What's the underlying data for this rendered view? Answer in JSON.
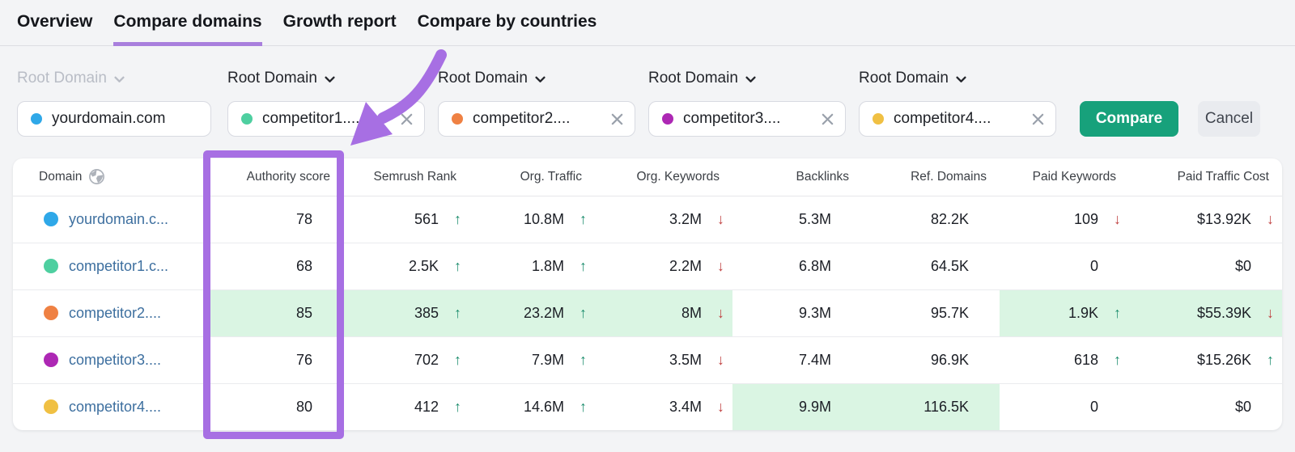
{
  "tabs": [
    {
      "label": "Overview",
      "active": false
    },
    {
      "label": "Compare domains",
      "active": true
    },
    {
      "label": "Growth report",
      "active": false
    },
    {
      "label": "Compare by countries",
      "active": false
    }
  ],
  "selectors": [
    {
      "type_label": "Root Domain",
      "disabled": true,
      "domain": "yourdomain.com",
      "dot_color": "#2fa8e8",
      "removable": false
    },
    {
      "type_label": "Root Domain",
      "disabled": false,
      "domain": "competitor1....",
      "dot_color": "#4ecfa0",
      "removable": true
    },
    {
      "type_label": "Root Domain",
      "disabled": false,
      "domain": "competitor2....",
      "dot_color": "#ef8143",
      "removable": true
    },
    {
      "type_label": "Root Domain",
      "disabled": false,
      "domain": "competitor3....",
      "dot_color": "#ad28b4",
      "removable": true
    },
    {
      "type_label": "Root Domain",
      "disabled": false,
      "domain": "competitor4....",
      "dot_color": "#f0c043",
      "removable": true
    }
  ],
  "actions": {
    "compare_label": "Compare",
    "cancel_label": "Cancel"
  },
  "table": {
    "columns": [
      "Domain",
      "Authority score",
      "Semrush Rank",
      "Org. Traffic",
      "Org. Keywords",
      "Backlinks",
      "Ref. Domains",
      "Paid Keywords",
      "Paid Traffic Cost"
    ],
    "rows": [
      {
        "domain": "yourdomain.c...",
        "dot_color": "#2fa8e8",
        "authority": "78",
        "semrush_rank": {
          "value": "561",
          "trend": "up"
        },
        "org_traffic": {
          "value": "10.8M",
          "trend": "up"
        },
        "org_keywords": {
          "value": "3.2M",
          "trend": "down"
        },
        "backlinks": {
          "value": "5.3M"
        },
        "ref_domains": {
          "value": "82.2K"
        },
        "paid_keywords": {
          "value": "109",
          "trend": "down"
        },
        "paid_traffic_cost": {
          "value": "$13.92K",
          "trend": "down"
        },
        "highlights": []
      },
      {
        "domain": "competitor1.c...",
        "dot_color": "#4ecfa0",
        "authority": "68",
        "semrush_rank": {
          "value": "2.5K",
          "trend": "up"
        },
        "org_traffic": {
          "value": "1.8M",
          "trend": "up"
        },
        "org_keywords": {
          "value": "2.2M",
          "trend": "down"
        },
        "backlinks": {
          "value": "6.8M"
        },
        "ref_domains": {
          "value": "64.5K"
        },
        "paid_keywords": {
          "value": "0"
        },
        "paid_traffic_cost": {
          "value": "$0"
        },
        "highlights": []
      },
      {
        "domain": "competitor2....",
        "dot_color": "#ef8143",
        "authority": "85",
        "semrush_rank": {
          "value": "385",
          "trend": "up"
        },
        "org_traffic": {
          "value": "23.2M",
          "trend": "up"
        },
        "org_keywords": {
          "value": "8M",
          "trend": "down"
        },
        "backlinks": {
          "value": "9.3M"
        },
        "ref_domains": {
          "value": "95.7K"
        },
        "paid_keywords": {
          "value": "1.9K",
          "trend": "up"
        },
        "paid_traffic_cost": {
          "value": "$55.39K",
          "trend": "down"
        },
        "highlights": [
          "authority",
          "semrush_rank",
          "org_traffic",
          "org_keywords",
          "paid_keywords",
          "paid_traffic_cost"
        ]
      },
      {
        "domain": "competitor3....",
        "dot_color": "#ad28b4",
        "authority": "76",
        "semrush_rank": {
          "value": "702",
          "trend": "up"
        },
        "org_traffic": {
          "value": "7.9M",
          "trend": "up"
        },
        "org_keywords": {
          "value": "3.5M",
          "trend": "down"
        },
        "backlinks": {
          "value": "7.4M"
        },
        "ref_domains": {
          "value": "96.9K"
        },
        "paid_keywords": {
          "value": "618",
          "trend": "up"
        },
        "paid_traffic_cost": {
          "value": "$15.26K",
          "trend": "up"
        },
        "highlights": []
      },
      {
        "domain": "competitor4....",
        "dot_color": "#f0c043",
        "authority": "80",
        "semrush_rank": {
          "value": "412",
          "trend": "up"
        },
        "org_traffic": {
          "value": "14.6M",
          "trend": "up"
        },
        "org_keywords": {
          "value": "3.4M",
          "trend": "down"
        },
        "backlinks": {
          "value": "9.9M"
        },
        "ref_domains": {
          "value": "116.5K"
        },
        "paid_keywords": {
          "value": "0"
        },
        "paid_traffic_cost": {
          "value": "$0"
        },
        "highlights": [
          "backlinks",
          "ref_domains"
        ]
      }
    ]
  },
  "colors": {
    "annotation_purple": "#a76fe3",
    "tab_underline": "#a97fdd",
    "compare_button": "#17a17b",
    "highlight_green": "#daf5e3",
    "trend_up": "#1e8e6e",
    "trend_down": "#c04040"
  }
}
